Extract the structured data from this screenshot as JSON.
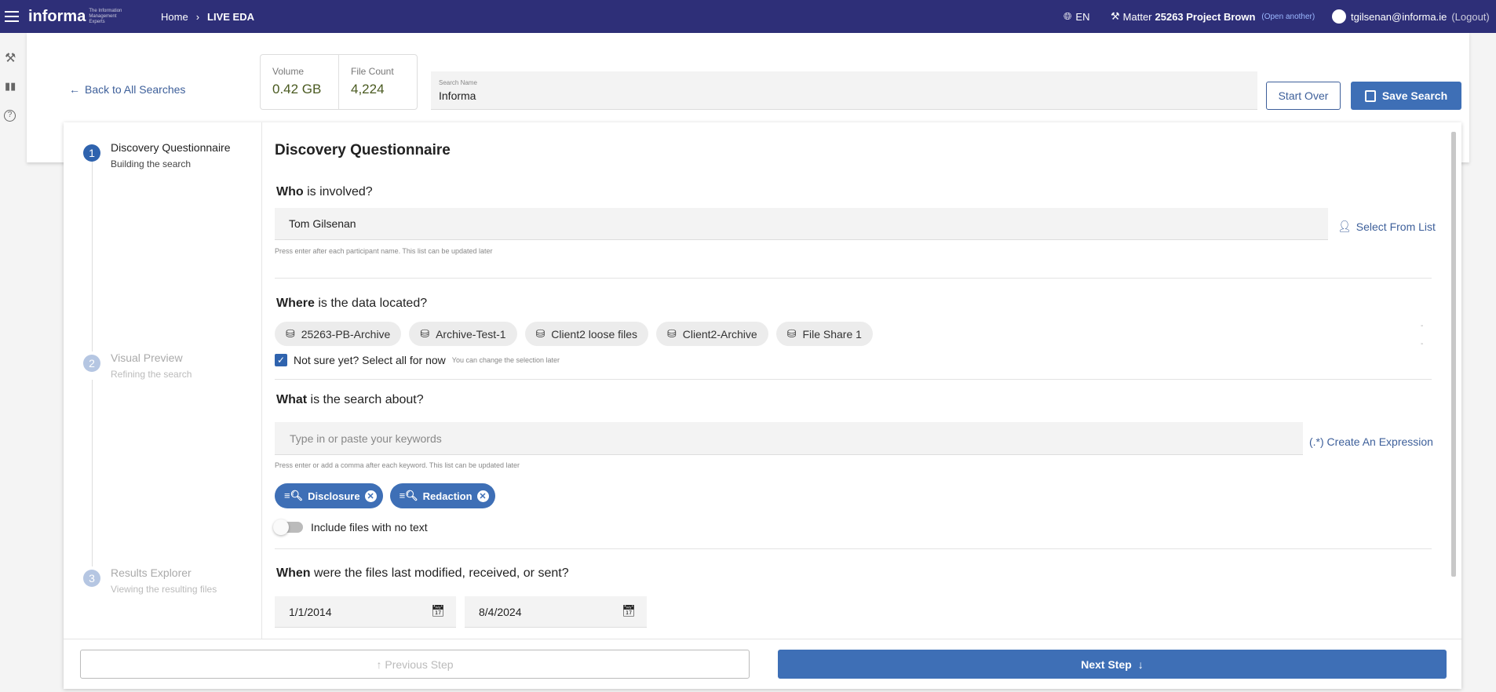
{
  "header": {
    "logo": "informa",
    "logo_tagline": "The Information Management Experts",
    "breadcrumb_home": "Home",
    "breadcrumb_current": "LIVE EDA",
    "language": "EN",
    "matter_prefix": "Matter",
    "matter_name": "25263 Project Brown",
    "open_another": "(Open another)",
    "user_email": "tgilsenan@informa.ie",
    "logout": "(Logout)"
  },
  "top": {
    "back_link": "Back to All Searches",
    "volume_label": "Volume",
    "volume_value": "0.42 GB",
    "file_count_label": "File Count",
    "file_count_value": "4,224",
    "search_name_label": "Search Name",
    "search_name_value": "Informa",
    "start_over": "Start Over",
    "save_search": "Save Search"
  },
  "steps": [
    {
      "num": "1",
      "title": "Discovery Questionnaire",
      "subtitle": "Building the search",
      "active": true
    },
    {
      "num": "2",
      "title": "Visual Preview",
      "subtitle": "Refining the search",
      "active": false
    },
    {
      "num": "3",
      "title": "Results Explorer",
      "subtitle": "Viewing the resulting files",
      "active": false
    }
  ],
  "form": {
    "title": "Discovery Questionnaire",
    "who": {
      "q_bold": "Who",
      "q_rest": " is involved?",
      "value": "Tom Gilsenan",
      "help": "Press enter after each participant name. This list can be updated later",
      "select_from_list": "Select From List"
    },
    "where": {
      "q_bold": "Where",
      "q_rest": " is the data located?",
      "sources": [
        "25263-PB-Archive",
        "Archive-Test-1",
        "Client2 loose files",
        "Client2-Archive",
        "File Share 1"
      ],
      "select_all_label": "Not sure yet? Select all for now",
      "select_all_checked": true,
      "select_all_hint": "You can change the selection later"
    },
    "what": {
      "q_bold": "What",
      "q_rest": " is the search about?",
      "placeholder": "Type in or paste your keywords",
      "help": "Press enter or add a comma after each keyword. This list can be updated later",
      "create_expression": "(.*) Create An Expression",
      "keywords": [
        "Disclosure",
        "Redaction"
      ],
      "include_no_text_label": "Include files with no text",
      "include_no_text": false
    },
    "when": {
      "q_bold": "When",
      "q_rest": " were the files last modified, received, or sent?",
      "from": "1/1/2014",
      "to": "8/4/2024"
    }
  },
  "footer": {
    "previous": "Previous Step",
    "next": "Next Step"
  },
  "colors": {
    "header": "#2e2f78",
    "accent": "#3e6fb6"
  }
}
